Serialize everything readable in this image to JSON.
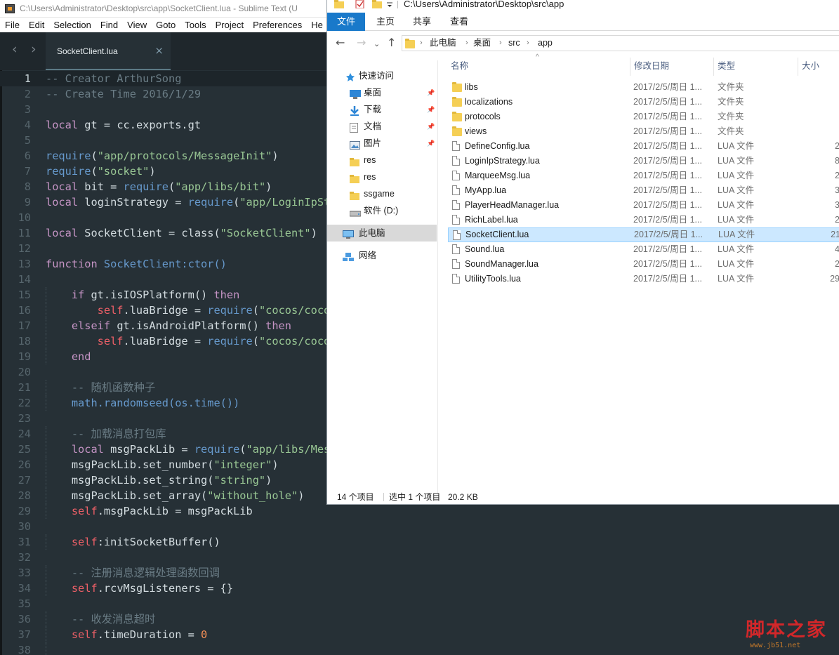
{
  "sublime": {
    "title": "C:\\Users\\Administrator\\Desktop\\src\\app\\SocketClient.lua - Sublime Text (U",
    "menu": [
      "File",
      "Edit",
      "Selection",
      "Find",
      "View",
      "Goto",
      "Tools",
      "Project",
      "Preferences",
      "He"
    ],
    "tab": {
      "name": "SocketClient.lua",
      "close": "×"
    },
    "nav": {
      "back": "‹",
      "forward": "›"
    },
    "current_line": 1,
    "colors": {
      "background": "#263036",
      "comment": "#6a7c85",
      "keyword": "#c594c5",
      "string": "#99c794",
      "function": "#6699cc",
      "self": "#ec5f67",
      "number": "#f99157"
    },
    "lines": [
      {
        "n": "1",
        "tokens": [
          {
            "t": "-- Creator ArthurSong",
            "c": "com"
          }
        ]
      },
      {
        "n": "2",
        "tokens": [
          {
            "t": "-- Create Time 2016/1/29",
            "c": "com"
          }
        ]
      },
      {
        "n": "3",
        "tokens": []
      },
      {
        "n": "4",
        "tokens": [
          {
            "t": "local",
            "c": "kw"
          },
          {
            "t": " gt = cc.exports.gt",
            "c": "var"
          }
        ]
      },
      {
        "n": "5",
        "tokens": []
      },
      {
        "n": "6",
        "tokens": [
          {
            "t": "require",
            "c": "fn"
          },
          {
            "t": "(",
            "c": "var"
          },
          {
            "t": "\"app/protocols/MessageInit\"",
            "c": "str"
          },
          {
            "t": ")",
            "c": "var"
          }
        ]
      },
      {
        "n": "7",
        "tokens": [
          {
            "t": "require",
            "c": "fn"
          },
          {
            "t": "(",
            "c": "var"
          },
          {
            "t": "\"socket\"",
            "c": "str"
          },
          {
            "t": ")",
            "c": "var"
          }
        ]
      },
      {
        "n": "8",
        "tokens": [
          {
            "t": "local",
            "c": "kw"
          },
          {
            "t": " bit = ",
            "c": "var"
          },
          {
            "t": "require",
            "c": "fn"
          },
          {
            "t": "(",
            "c": "var"
          },
          {
            "t": "\"app/libs/bit\"",
            "c": "str"
          },
          {
            "t": ")",
            "c": "var"
          }
        ]
      },
      {
        "n": "9",
        "tokens": [
          {
            "t": "local",
            "c": "kw"
          },
          {
            "t": " loginStrategy = ",
            "c": "var"
          },
          {
            "t": "require",
            "c": "fn"
          },
          {
            "t": "(",
            "c": "var"
          },
          {
            "t": "\"app/LoginIpStr",
            "c": "str"
          }
        ]
      },
      {
        "n": "10",
        "tokens": []
      },
      {
        "n": "11",
        "tokens": [
          {
            "t": "local",
            "c": "kw"
          },
          {
            "t": " SocketClient = class(",
            "c": "var"
          },
          {
            "t": "\"SocketClient\"",
            "c": "str"
          },
          {
            "t": ")",
            "c": "var"
          }
        ]
      },
      {
        "n": "12",
        "tokens": []
      },
      {
        "n": "13",
        "tokens": [
          {
            "t": "function",
            "c": "kw"
          },
          {
            "t": " SocketClient:ctor()",
            "c": "fn"
          }
        ]
      },
      {
        "n": "14",
        "tokens": []
      },
      {
        "n": "15",
        "tokens": [
          {
            "t": "    if",
            "c": "kw"
          },
          {
            "t": " gt.isIOSPlatform() ",
            "c": "var"
          },
          {
            "t": "then",
            "c": "kw"
          }
        ]
      },
      {
        "n": "16",
        "tokens": [
          {
            "t": "        self",
            "c": "self"
          },
          {
            "t": ".luaBridge = ",
            "c": "var"
          },
          {
            "t": "require",
            "c": "fn"
          },
          {
            "t": "(",
            "c": "var"
          },
          {
            "t": "\"cocos/cocos",
            "c": "str"
          }
        ]
      },
      {
        "n": "17",
        "tokens": [
          {
            "t": "    elseif",
            "c": "kw"
          },
          {
            "t": " gt.isAndroidPlatform() ",
            "c": "var"
          },
          {
            "t": "then",
            "c": "kw"
          }
        ]
      },
      {
        "n": "18",
        "tokens": [
          {
            "t": "        self",
            "c": "self"
          },
          {
            "t": ".luaBridge = ",
            "c": "var"
          },
          {
            "t": "require",
            "c": "fn"
          },
          {
            "t": "(",
            "c": "var"
          },
          {
            "t": "\"cocos/cocos",
            "c": "str"
          }
        ]
      },
      {
        "n": "19",
        "tokens": [
          {
            "t": "    end",
            "c": "kw"
          }
        ]
      },
      {
        "n": "20",
        "tokens": []
      },
      {
        "n": "21",
        "tokens": [
          {
            "t": "    -- 随机函数种子",
            "c": "com"
          }
        ]
      },
      {
        "n": "22",
        "tokens": [
          {
            "t": "    math.randomseed(os.time())",
            "c": "fn"
          }
        ]
      },
      {
        "n": "23",
        "tokens": []
      },
      {
        "n": "24",
        "tokens": [
          {
            "t": "    -- 加载消息打包库",
            "c": "com"
          }
        ]
      },
      {
        "n": "25",
        "tokens": [
          {
            "t": "    local",
            "c": "kw"
          },
          {
            "t": " msgPackLib = ",
            "c": "var"
          },
          {
            "t": "require",
            "c": "fn"
          },
          {
            "t": "(",
            "c": "var"
          },
          {
            "t": "\"app/libs/Mess",
            "c": "str"
          }
        ]
      },
      {
        "n": "26",
        "tokens": [
          {
            "t": "    msgPackLib.set_number(",
            "c": "var"
          },
          {
            "t": "\"integer\"",
            "c": "str"
          },
          {
            "t": ")",
            "c": "var"
          }
        ]
      },
      {
        "n": "27",
        "tokens": [
          {
            "t": "    msgPackLib.set_string(",
            "c": "var"
          },
          {
            "t": "\"string\"",
            "c": "str"
          },
          {
            "t": ")",
            "c": "var"
          }
        ]
      },
      {
        "n": "28",
        "tokens": [
          {
            "t": "    msgPackLib.set_array(",
            "c": "var"
          },
          {
            "t": "\"without_hole\"",
            "c": "str"
          },
          {
            "t": ")",
            "c": "var"
          }
        ]
      },
      {
        "n": "29",
        "tokens": [
          {
            "t": "    self",
            "c": "self"
          },
          {
            "t": ".msgPackLib = msgPackLib",
            "c": "var"
          }
        ]
      },
      {
        "n": "30",
        "tokens": []
      },
      {
        "n": "31",
        "tokens": [
          {
            "t": "    self",
            "c": "self"
          },
          {
            "t": ":initSocketBuffer()",
            "c": "var"
          }
        ]
      },
      {
        "n": "32",
        "tokens": []
      },
      {
        "n": "33",
        "tokens": [
          {
            "t": "    -- 注册消息逻辑处理函数回调",
            "c": "com"
          }
        ]
      },
      {
        "n": "34",
        "tokens": [
          {
            "t": "    self",
            "c": "self"
          },
          {
            "t": ".rcvMsgListeners = {}",
            "c": "var"
          }
        ]
      },
      {
        "n": "35",
        "tokens": []
      },
      {
        "n": "36",
        "tokens": [
          {
            "t": "    -- 收发消息超时",
            "c": "com"
          }
        ]
      },
      {
        "n": "37",
        "tokens": [
          {
            "t": "    self",
            "c": "self"
          },
          {
            "t": ".timeDuration = ",
            "c": "var"
          },
          {
            "t": "0",
            "c": "num"
          }
        ]
      },
      {
        "n": "38",
        "tokens": []
      }
    ]
  },
  "explorer": {
    "title": "C:\\Users\\Administrator\\Desktop\\src\\app",
    "ribbon": {
      "file": "文件",
      "home": "主页",
      "share": "共享",
      "view": "查看"
    },
    "address": {
      "crumbs": [
        "此电脑",
        "桌面",
        "src",
        "app"
      ],
      "separator": "›"
    },
    "nav_buttons": {
      "back": "←",
      "forward": "→",
      "recent": "⌄",
      "up": "↑"
    },
    "sidebar": [
      {
        "label": "快速访问",
        "icon": "star-icon",
        "pinned": false
      },
      {
        "label": "桌面",
        "icon": "desktop-icon",
        "pinned": true
      },
      {
        "label": "下载",
        "icon": "download-icon",
        "pinned": true
      },
      {
        "label": "文档",
        "icon": "document-icon",
        "pinned": true
      },
      {
        "label": "图片",
        "icon": "picture-icon",
        "pinned": true
      },
      {
        "label": "res",
        "icon": "folder-icon",
        "pinned": false
      },
      {
        "label": "res",
        "icon": "folder-icon",
        "pinned": false
      },
      {
        "label": "ssgame",
        "icon": "folder-icon",
        "pinned": false
      },
      {
        "label": "软件 (D:)",
        "icon": "drive-icon",
        "pinned": false
      },
      {
        "label": "此电脑",
        "icon": "computer-icon",
        "pinned": false,
        "selected": true
      },
      {
        "label": "网络",
        "icon": "network-icon",
        "pinned": false
      }
    ],
    "columns": {
      "name": "名称",
      "date": "修改日期",
      "type": "类型",
      "size": "大小",
      "sort_indicator": "^"
    },
    "files": [
      {
        "name": "libs",
        "date": "2017/2/5/周日 1...",
        "type": "文件夹",
        "size": "",
        "kind": "folder"
      },
      {
        "name": "localizations",
        "date": "2017/2/5/周日 1...",
        "type": "文件夹",
        "size": "",
        "kind": "folder"
      },
      {
        "name": "protocols",
        "date": "2017/2/5/周日 1...",
        "type": "文件夹",
        "size": "",
        "kind": "folder"
      },
      {
        "name": "views",
        "date": "2017/2/5/周日 1...",
        "type": "文件夹",
        "size": "",
        "kind": "folder"
      },
      {
        "name": "DefineConfig.lua",
        "date": "2017/2/5/周日 1...",
        "type": "LUA 文件",
        "size": "2",
        "kind": "file"
      },
      {
        "name": "LoginIpStrategy.lua",
        "date": "2017/2/5/周日 1...",
        "type": "LUA 文件",
        "size": "8",
        "kind": "file"
      },
      {
        "name": "MarqueeMsg.lua",
        "date": "2017/2/5/周日 1...",
        "type": "LUA 文件",
        "size": "2",
        "kind": "file"
      },
      {
        "name": "MyApp.lua",
        "date": "2017/2/5/周日 1...",
        "type": "LUA 文件",
        "size": "3",
        "kind": "file"
      },
      {
        "name": "PlayerHeadManager.lua",
        "date": "2017/2/5/周日 1...",
        "type": "LUA 文件",
        "size": "3",
        "kind": "file"
      },
      {
        "name": "RichLabel.lua",
        "date": "2017/2/5/周日 1...",
        "type": "LUA 文件",
        "size": "2",
        "kind": "file"
      },
      {
        "name": "SocketClient.lua",
        "date": "2017/2/5/周日 1...",
        "type": "LUA 文件",
        "size": "21",
        "kind": "file",
        "selected": true
      },
      {
        "name": "Sound.lua",
        "date": "2017/2/5/周日 1...",
        "type": "LUA 文件",
        "size": "4",
        "kind": "file"
      },
      {
        "name": "SoundManager.lua",
        "date": "2017/2/5/周日 1...",
        "type": "LUA 文件",
        "size": "2",
        "kind": "file"
      },
      {
        "name": "UtilityTools.lua",
        "date": "2017/2/5/周日 1...",
        "type": "LUA 文件",
        "size": "29",
        "kind": "file"
      }
    ],
    "status": {
      "count": "14 个项目",
      "selected": "选中 1 个项目",
      "size": "20.2 KB"
    }
  },
  "watermark": {
    "text": "脚本之家",
    "url": "www.jb51.net"
  }
}
